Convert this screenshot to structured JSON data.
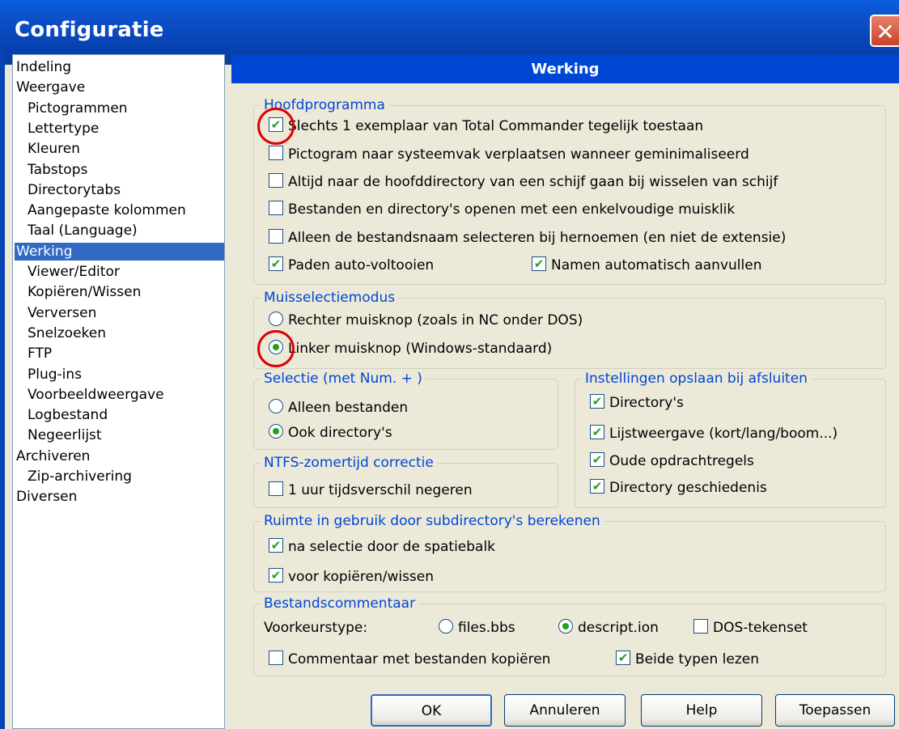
{
  "window": {
    "title": "Configuratie",
    "close_glyph": "✕",
    "accent": "#0046d5",
    "selection_color": "#316ac5",
    "check_color": "#21a121"
  },
  "tree": {
    "items": [
      {
        "label": "Indeling",
        "level": 0
      },
      {
        "label": "Weergave",
        "level": 0
      },
      {
        "label": "Pictogrammen",
        "level": 1
      },
      {
        "label": "Lettertype",
        "level": 1
      },
      {
        "label": "Kleuren",
        "level": 1
      },
      {
        "label": "Tabstops",
        "level": 1
      },
      {
        "label": "Directorytabs",
        "level": 1
      },
      {
        "label": "Aangepaste kolommen",
        "level": 1
      },
      {
        "label": "Taal (Language)",
        "level": 1
      },
      {
        "label": "Werking",
        "level": 0,
        "selected": true
      },
      {
        "label": "Viewer/Editor",
        "level": 1
      },
      {
        "label": "Kopiëren/Wissen",
        "level": 1
      },
      {
        "label": "Verversen",
        "level": 1
      },
      {
        "label": "Snelzoeken",
        "level": 1
      },
      {
        "label": "FTP",
        "level": 1
      },
      {
        "label": "Plug-ins",
        "level": 1
      },
      {
        "label": "Voorbeeldweergave",
        "level": 1
      },
      {
        "label": "Logbestand",
        "level": 1
      },
      {
        "label": "Negeerlijst",
        "level": 1
      },
      {
        "label": "Archiveren",
        "level": 0
      },
      {
        "label": "Zip-archivering",
        "level": 1
      },
      {
        "label": "Diversen",
        "level": 0
      }
    ]
  },
  "panel": {
    "header": "Werking"
  },
  "hoofdprogramma": {
    "title": "Hoofdprogramma",
    "options": [
      {
        "label": "Slechts 1 exemplaar van Total Commander tegelijk toestaan",
        "checked": true
      },
      {
        "label": "Pictogram naar systeemvak verplaatsen wanneer geminimaliseerd",
        "checked": false
      },
      {
        "label": "Altijd naar de hoofddirectory van een schijf gaan bij wisselen van schijf",
        "checked": false
      },
      {
        "label": "Bestanden en directory's openen met een enkelvoudige muisklik",
        "checked": false
      },
      {
        "label": "Alleen de bestandsnaam selecteren bij hernoemen (en niet de extensie)",
        "checked": false
      },
      {
        "label": "Paden auto-voltooien",
        "checked": true
      },
      {
        "label": "Namen automatisch aanvullen",
        "checked": true
      }
    ]
  },
  "muisselectie": {
    "title": "Muisselectiemodus",
    "options": [
      {
        "label": "Rechter muisknop (zoals in NC onder DOS)",
        "selected": false
      },
      {
        "label": "Linker muisknop (Windows-standaard)",
        "selected": true
      }
    ]
  },
  "selectie": {
    "title": "Selectie (met Num. + )",
    "options": [
      {
        "label": "Alleen bestanden",
        "selected": false
      },
      {
        "label": "Ook directory's",
        "selected": true
      }
    ]
  },
  "opslaan": {
    "title": "Instellingen opslaan bij afsluiten",
    "options": [
      {
        "label": "Directory's",
        "checked": true
      },
      {
        "label": "Lijstweergave (kort/lang/boom...)",
        "checked": true
      },
      {
        "label": "Oude opdrachtregels",
        "checked": true
      },
      {
        "label": "Directory geschiedenis",
        "checked": true
      }
    ]
  },
  "ntfs": {
    "title": "NTFS-zomertijd correctie",
    "options": [
      {
        "label": "1 uur tijdsverschil negeren",
        "checked": false
      }
    ]
  },
  "ruimte": {
    "title": "Ruimte in gebruik door subdirectory's berekenen",
    "options": [
      {
        "label": "na selectie door de spatiebalk",
        "checked": true
      },
      {
        "label": "voor kopiëren/wissen",
        "checked": true
      }
    ]
  },
  "commentaar": {
    "title": "Bestandscommentaar",
    "voorkeur_label": "Voorkeurstype:",
    "types": [
      {
        "label": "files.bbs",
        "selected": false
      },
      {
        "label": "descript.ion",
        "selected": true
      }
    ],
    "dos": {
      "label": "DOS-tekenset",
      "checked": false
    },
    "kopieren": {
      "label": "Commentaar met bestanden kopiëren",
      "checked": false
    },
    "beide": {
      "label": "Beide typen lezen",
      "checked": true
    }
  },
  "buttons": {
    "ok": "OK",
    "annuleren": "Annuleren",
    "help": "Help",
    "toepassen": "Toepassen"
  },
  "check_glyph": "✔"
}
